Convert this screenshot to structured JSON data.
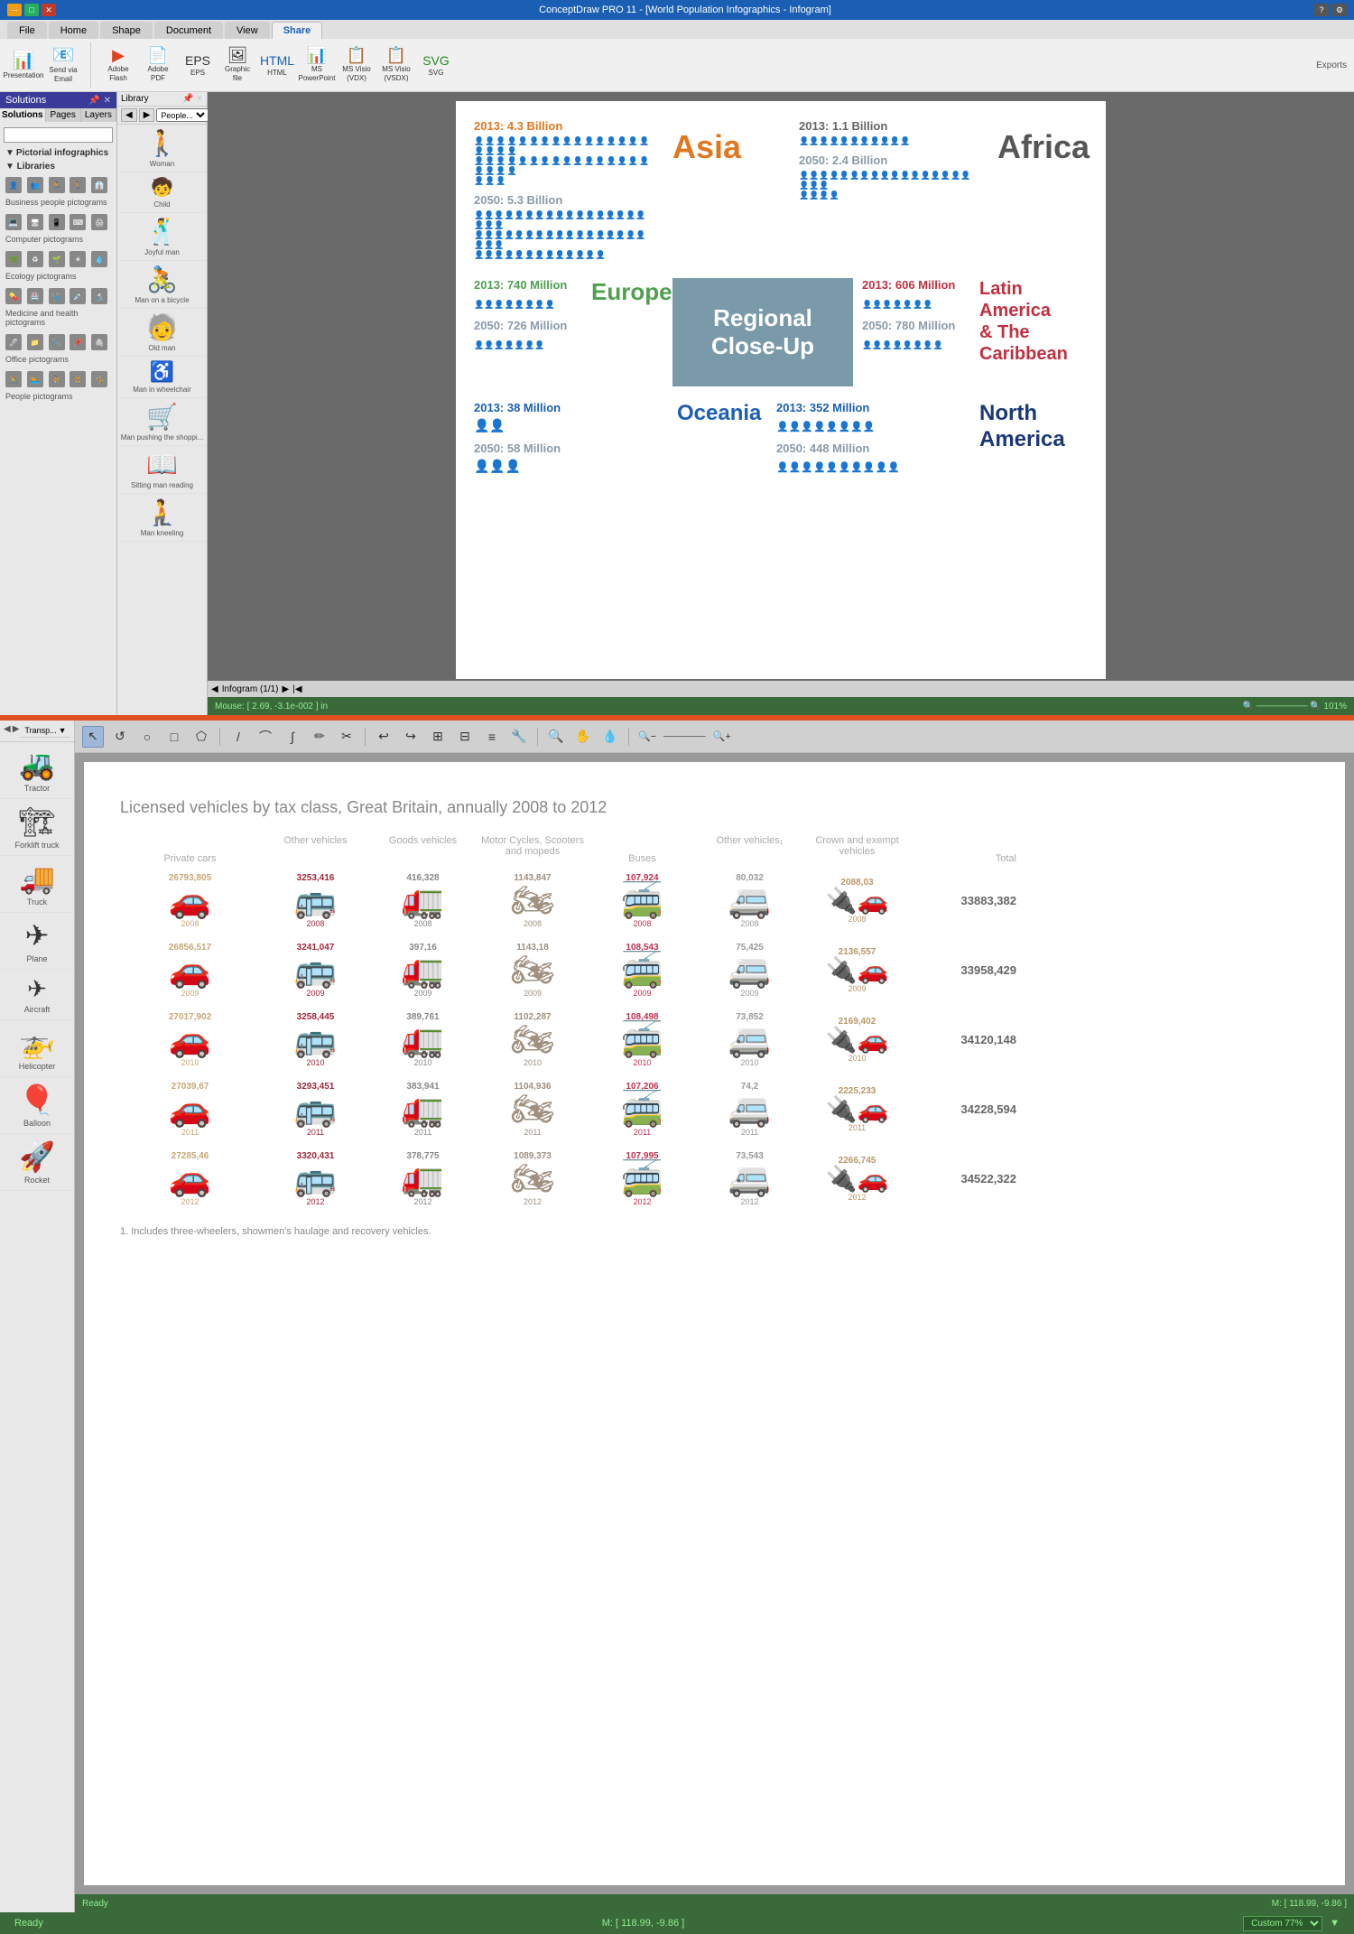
{
  "app": {
    "title": "ConceptDraw PRO 11 - [World Population Infographics - Infogram]",
    "status_top": "Mouse: [ 2.69, -3.1e-002 ] in",
    "zoom_top": "101%"
  },
  "ribbon": {
    "tabs": [
      "File",
      "Home",
      "Shape",
      "Document",
      "View",
      "Share"
    ],
    "active_tab": "Share",
    "groups": {
      "presentation": "Presentation",
      "email": "Send via\nEmail",
      "adobe_flash": "Adobe Flash",
      "adobe_pdf": "Adobe PDF",
      "eps": "EPS",
      "graphic_file": "Graphic\nfile",
      "html": "HTML",
      "ms_powerpoint": "MS\nPowerPoint",
      "ms_visio_vdx": "MS Visio\n(VDX)",
      "ms_visio_vsdx": "MS Visio\n(VSDX)",
      "svg": "SVG"
    }
  },
  "solutions_panel": {
    "title": "Solutions",
    "tabs": [
      "Solutions",
      "Pages",
      "Layers"
    ],
    "search_placeholder": "",
    "sections": [
      {
        "label": "Pictorial infographics",
        "active": true
      }
    ],
    "libraries_label": "Libraries",
    "library_sections": [
      "Business people pictograms",
      "Computer pictograms",
      "Ecology pictograms",
      "Medicine and health pictograms",
      "Office pictograms",
      "People pictograms"
    ]
  },
  "library_panel": {
    "title": "Library",
    "dropdown": "People...",
    "items": [
      {
        "label": "Woman",
        "icon": "🚶"
      },
      {
        "label": "Child",
        "icon": "🧒"
      },
      {
        "label": "Joyful man",
        "icon": "🕺"
      },
      {
        "label": "Man on a bicycle",
        "icon": "🚴"
      },
      {
        "label": "Old man",
        "icon": "🧓"
      },
      {
        "label": "Man in wheelchair",
        "icon": "♿"
      },
      {
        "label": "Man pushing the shoppi...",
        "icon": "🛒"
      },
      {
        "label": "Sitting man reading",
        "icon": "📖"
      },
      {
        "label": "Man kneeling",
        "icon": "🧎"
      }
    ]
  },
  "infographic": {
    "regions": [
      {
        "id": "asia",
        "year_2013_label": "2013: 4.3 Billion",
        "year_2050_label": "2050: 5.3 Billion",
        "name": "Asia",
        "name_color": "#e07820",
        "people_2013": 43,
        "people_2050": 53,
        "color_2013": "#e07820",
        "color_2050": "#8a9aaa"
      },
      {
        "id": "africa",
        "year_2013_label": "2013: 1.1 Billion",
        "year_2050_label": "2050: 2.4 Billion",
        "name": "Africa",
        "name_color": "#555",
        "people_2013": 11,
        "people_2050": 24,
        "color_2013": "#7a6a5a",
        "color_2050": "#8a9aaa"
      }
    ],
    "regions_row2": [
      {
        "id": "europe",
        "year_2013_label": "2013: 740 Million",
        "year_2050_label": "2050: 726 Million",
        "name": "Europe",
        "name_color": "#50a050",
        "people_2013": 8,
        "people_2050": 7,
        "color_2013": "#50a050",
        "color_2050": "#8a9aaa"
      },
      {
        "id": "latam",
        "year_2013_label": "2013: 606 Million",
        "year_2050_label": "2050: 780 Million",
        "name": "Latin America\n& The Caribbean",
        "name_color": "#c03040",
        "people_2013": 7,
        "people_2050": 8,
        "color_2013": "#c03040",
        "color_2050": "#8a9aaa"
      }
    ],
    "regions_row3": [
      {
        "id": "oceania",
        "year_2013_label": "2013: 38 Million",
        "year_2050_label": "2050: 58 Million",
        "name": "Oceania",
        "name_color": "#1a5fb4",
        "people_2013": 2,
        "people_2050": 3,
        "color_2013": "#1a5fb4",
        "color_2050": "#8a9aaa"
      },
      {
        "id": "northam",
        "year_2013_label": "2013: 352 Million",
        "year_2050_label": "2050: 448 Million",
        "name": "North\nAmerica",
        "name_color": "#1a3878",
        "people_2013": 8,
        "people_2050": 10,
        "color_2013": "#1a5fb4",
        "color_2050": "#8a9aaa"
      }
    ],
    "regional_closeup": "Regional Close-Up"
  },
  "vehicle_panel": {
    "nav_back": "◀",
    "nav_fwd": "▶",
    "dropdown_label": "Transp...",
    "items": [
      {
        "label": "Tractor",
        "icon": "🚜"
      },
      {
        "label": "Forklift truck",
        "icon": "🚛"
      },
      {
        "label": "Truck",
        "icon": "🚚"
      },
      {
        "label": "Plane",
        "icon": "✈"
      },
      {
        "label": "Aircraft",
        "icon": "✈"
      },
      {
        "label": "Helicopter",
        "icon": "🚁"
      },
      {
        "label": "Balloon",
        "icon": "🎈"
      },
      {
        "label": "Rocket",
        "icon": "🚀"
      }
    ]
  },
  "chart": {
    "title": "Licensed vehicles by tax class, Great Britain, annually 2008 to 2012",
    "columns": {
      "private_cars": "Private cars",
      "other_vehicles": "Other\nvehicles",
      "goods_vehicles": "Goods\nvehicles",
      "motorcycles": "Motor Cycles,\nScooters and\nmopeds",
      "buses": "Buses",
      "other_vehicles1": "Other\nvehicles₁",
      "crown_exempt": "Crown and\nexempt\nvehicles",
      "total": "Total"
    },
    "rows": [
      {
        "year": "2008",
        "private_cars_val": "26793,805",
        "other_vehicles_val": "3253,416",
        "goods_val": "416,328",
        "moto_val": "1143,847",
        "buses_val": "107,924",
        "other1_val": "80,032",
        "crown_val": "2088,03",
        "total": "33883,382"
      },
      {
        "year": "2009",
        "private_cars_val": "26856,517",
        "other_vehicles_val": "3241,047",
        "goods_val": "397,16",
        "moto_val": "1143,18",
        "buses_val": "108,543",
        "other1_val": "75,425",
        "crown_val": "2136,557",
        "total": "33958,429"
      },
      {
        "year": "2010",
        "private_cars_val": "27017,902",
        "other_vehicles_val": "3258,445",
        "goods_val": "389,761",
        "moto_val": "1102,287",
        "buses_val": "108,498",
        "other1_val": "73,852",
        "crown_val": "2169,402",
        "total": "34120,148"
      },
      {
        "year": "2011",
        "private_cars_val": "27039,67",
        "other_vehicles_val": "3293,451",
        "goods_val": "383,941",
        "moto_val": "1104,936",
        "buses_val": "107,206",
        "other1_val": "74,2",
        "crown_val": "2225,233",
        "total": "34228,594"
      },
      {
        "year": "2012",
        "private_cars_val": "27285,46",
        "other_vehicles_val": "3320,431",
        "goods_val": "378,775",
        "moto_val": "1089,373",
        "buses_val": "107,995",
        "other1_val": "73,543",
        "crown_val": "2266,745",
        "total": "34522,322"
      }
    ],
    "footnote": "1. Includes three-wheelers, showmen's haulage and recovery vehicles."
  },
  "bottom_status": {
    "left": "Ready",
    "center": "M: [ 118.99, -9.86 ]",
    "zoom_label": "Custom 77%"
  },
  "canvas_page": "Infogram (1/1)"
}
